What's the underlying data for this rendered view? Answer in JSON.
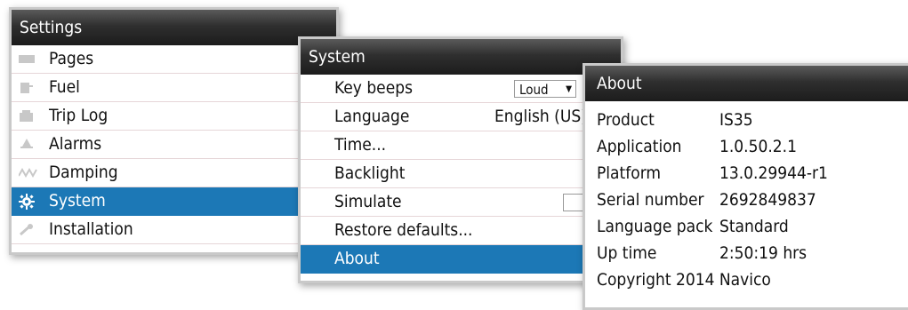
{
  "settings": {
    "title": "Settings",
    "items": [
      {
        "label": "Pages",
        "icon": "pages-icon"
      },
      {
        "label": "Fuel",
        "icon": "fuel-icon"
      },
      {
        "label": "Trip Log",
        "icon": "trip-log-icon"
      },
      {
        "label": "Alarms",
        "icon": "bell-icon"
      },
      {
        "label": "Damping",
        "icon": "damping-icon"
      },
      {
        "label": "System",
        "icon": "gear-icon",
        "selected": true
      },
      {
        "label": "Installation",
        "icon": "wrench-icon"
      }
    ]
  },
  "system": {
    "title": "System",
    "items": [
      {
        "label": "Key beeps",
        "value": "Loud"
      },
      {
        "label": "Language",
        "value": "English (US)"
      },
      {
        "label": "Time..."
      },
      {
        "label": "Backlight"
      },
      {
        "label": "Simulate",
        "checked": false
      },
      {
        "label": "Restore defaults..."
      },
      {
        "label": "About",
        "selected": true
      }
    ]
  },
  "about": {
    "title": "About",
    "rows": [
      {
        "key": "Product",
        "value": "IS35"
      },
      {
        "key": "Application",
        "value": "1.0.50.2.1"
      },
      {
        "key": "Platform",
        "value": "13.0.29944-r1"
      },
      {
        "key": "Serial number",
        "value": "2692849837"
      },
      {
        "key": "Language pack",
        "value": "Standard"
      },
      {
        "key": "Up time",
        "value": "2:50:19 hrs"
      }
    ],
    "copyright": "Copyright 2014 Navico"
  },
  "colors": {
    "selected": "#1c78b6",
    "titlebar": "#2f2f2f"
  }
}
